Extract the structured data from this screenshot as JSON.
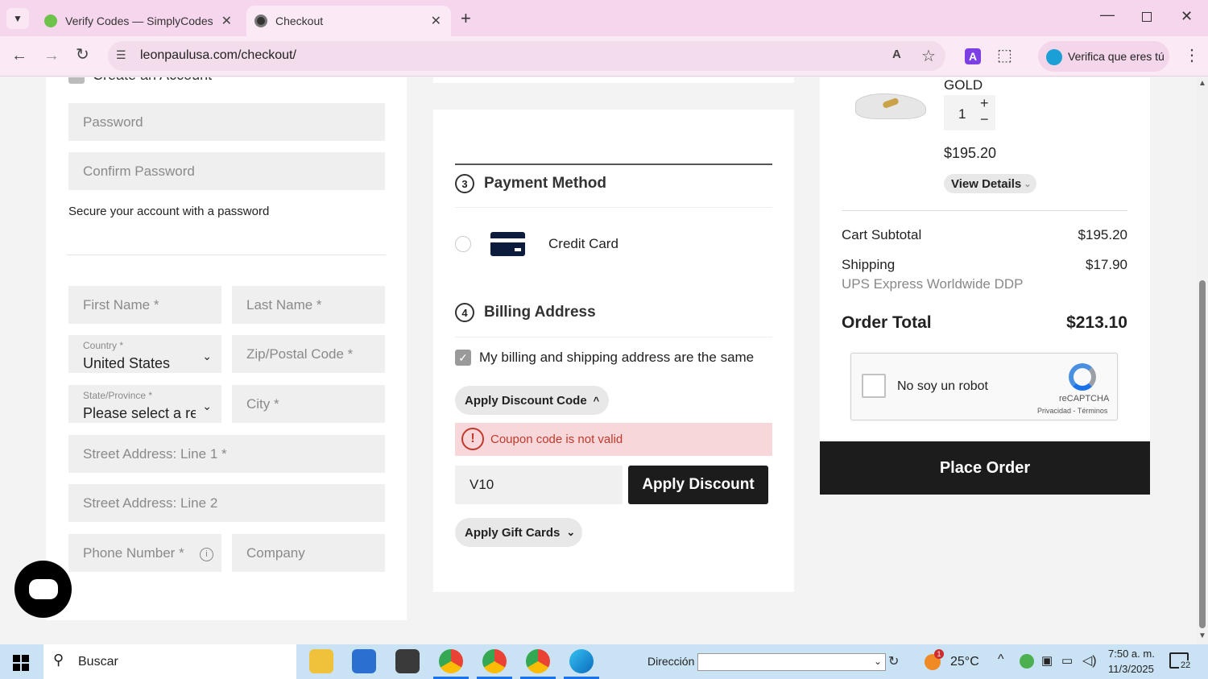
{
  "browser": {
    "tabs": [
      {
        "title": "Verify Codes — SimplyCodes",
        "active": false
      },
      {
        "title": "Checkout",
        "active": true
      }
    ],
    "url": "leonpaulusa.com/checkout/",
    "profile_label": "Verifica que eres tú"
  },
  "account": {
    "create_account_label": "Create an Account",
    "password_placeholder": "Password",
    "confirm_password_placeholder": "Confirm Password",
    "hint": "Secure your account with a password"
  },
  "address": {
    "first_name": "First Name *",
    "last_name": "Last Name *",
    "country_label": "Country *",
    "country_value": "United States",
    "zip": "Zip/Postal Code *",
    "state_label": "State/Province *",
    "state_value": "Please select a region",
    "city": "City *",
    "street1": "Street Address: Line 1 *",
    "street2": "Street Address: Line 2",
    "phone": "Phone Number *",
    "company": "Company"
  },
  "payment": {
    "step3_num": "3",
    "step3_title": "Payment Method",
    "credit_card_label": "Credit Card",
    "step4_num": "4",
    "step4_title": "Billing Address",
    "billing_same_label": "My billing and shipping address are the same",
    "discount_toggle": "Apply Discount Code",
    "error_message": "Coupon code is not valid",
    "discount_value": "V10",
    "apply_discount_button": "Apply Discount",
    "gift_cards_toggle": "Apply Gift Cards"
  },
  "summary": {
    "product_variant": "GOLD",
    "quantity": "1",
    "price": "$195.20",
    "view_details": "View Details",
    "subtotal_label": "Cart Subtotal",
    "subtotal_value": "$195.20",
    "shipping_label": "Shipping",
    "shipping_value": "$17.90",
    "shipping_method": "UPS Express Worldwide DDP",
    "total_label": "Order Total",
    "total_value": "$213.10",
    "recaptcha_label": "No soy un robot",
    "recaptcha_brand": "reCAPTCHA",
    "recaptcha_links": "Privacidad - Términos",
    "place_order_button": "Place Order"
  },
  "taskbar": {
    "search_placeholder": "Buscar",
    "address_label": "Dirección",
    "weather": "25°C",
    "weather_badge": "1",
    "time": "7:50 a. m.",
    "date": "11/3/2025",
    "notifications": "22"
  },
  "colors": {
    "tabbar_bg": "#f6d6ec",
    "error_bg": "#f8d7da",
    "error_text": "#c0392b",
    "button_dark": "#1c1c1c"
  }
}
